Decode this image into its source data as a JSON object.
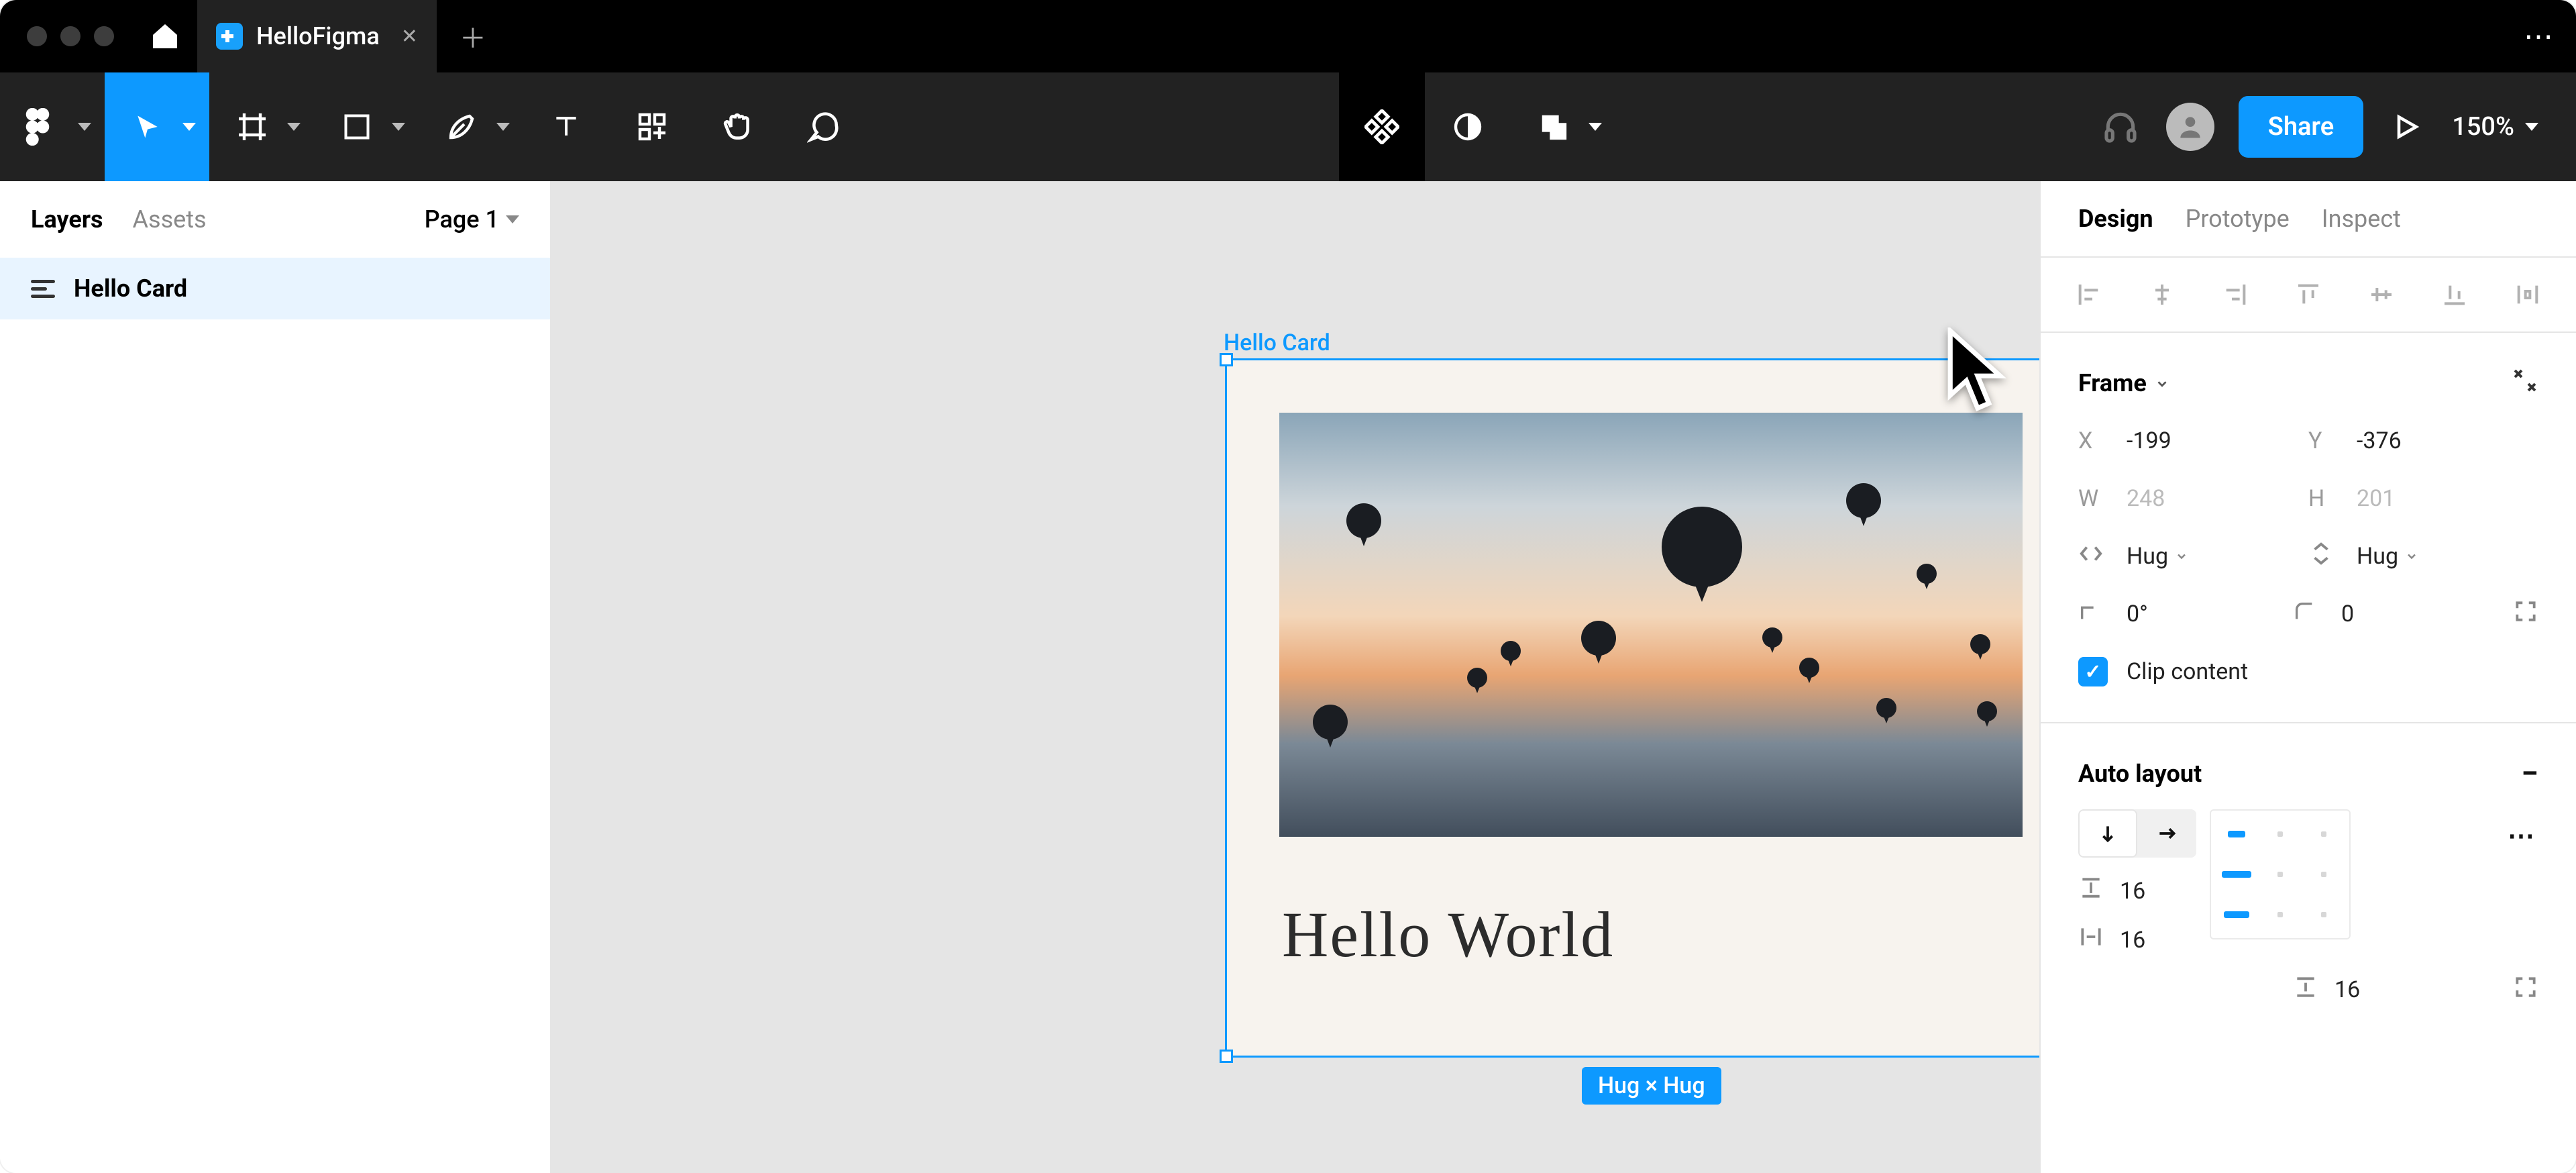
{
  "titlebar": {
    "tab_title": "HelloFigma"
  },
  "toolbar": {
    "zoom": "150%",
    "share_label": "Share"
  },
  "left_panel": {
    "tab_layers": "Layers",
    "tab_assets": "Assets",
    "page_selector": "Page 1",
    "layers": [
      {
        "name": "Hello Card"
      }
    ]
  },
  "canvas": {
    "selection_label": "Hello Card",
    "card_text": "Hello World",
    "dimension_badge": "Hug × Hug"
  },
  "right_panel": {
    "tab_design": "Design",
    "tab_prototype": "Prototype",
    "tab_inspect": "Inspect",
    "frame": {
      "section_title": "Frame",
      "X": "-199",
      "Y": "-376",
      "W": "248",
      "H": "201",
      "horizontal_resize": "Hug",
      "vertical_resize": "Hug",
      "rotation": "0°",
      "corner_radius": "0",
      "clip_content_label": "Clip content",
      "clip_content_checked": true
    },
    "auto_layout": {
      "section_title": "Auto layout",
      "direction": "vertical",
      "spacing_between": "16",
      "padding_horizontal": "16",
      "padding_vertical": "16"
    }
  }
}
